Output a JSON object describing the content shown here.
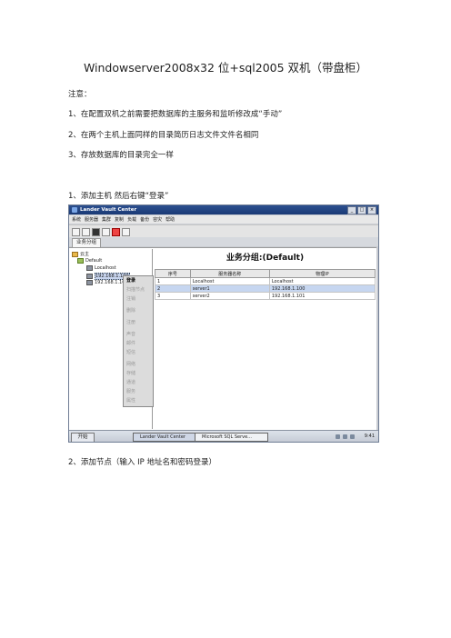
{
  "doc": {
    "title": "Windowserver2008x32 位+sql2005 双机（带盘柜）",
    "note_label": "注意：",
    "notes": [
      "1、在配置双机之前需要把数据库的主服务和监听修改成“手动”",
      "2、在两个主机上面同样的目录简历日志文件文件名相同",
      "3、存放数据库的目录完全一样"
    ],
    "step1": "1、添加主机 然后右键“登录”",
    "step2": "2、添加节点（输入 IP 地址名和密码登录）"
  },
  "app": {
    "window_title": "Lander Vault Center",
    "win_min": "_",
    "win_max": "□",
    "win_close": "×",
    "menu": [
      "系统",
      "服务器",
      "集群",
      "复制",
      "负载",
      "备份",
      "容灾",
      "帮助"
    ],
    "tab": "业务分组",
    "tree": {
      "root": "云主",
      "group": "Default",
      "nodes": [
        "Localhost",
        "192.168.1.100",
        "192.168.1.101"
      ]
    },
    "context_menu": [
      "登录",
      "扫描节点",
      "注销",
      "删除",
      "注册",
      "声音",
      "邮件",
      "短信",
      "网络",
      "存储",
      "通道",
      "服务",
      "属性"
    ],
    "group_title": "业务分组:(Default)",
    "table": {
      "headers": [
        "序号",
        "服务器名称",
        "物理IP"
      ],
      "rows": [
        [
          "1",
          "Localhost",
          "Localhost"
        ],
        [
          "2",
          "server1",
          "192.168.1.100"
        ],
        [
          "3",
          "server2",
          "192.168.1.101"
        ]
      ]
    },
    "taskbar": {
      "start": "开始",
      "tasks": [
        "Lander Vault Center",
        "Microsoft SQL Serve..."
      ],
      "clock": "9:41"
    }
  }
}
